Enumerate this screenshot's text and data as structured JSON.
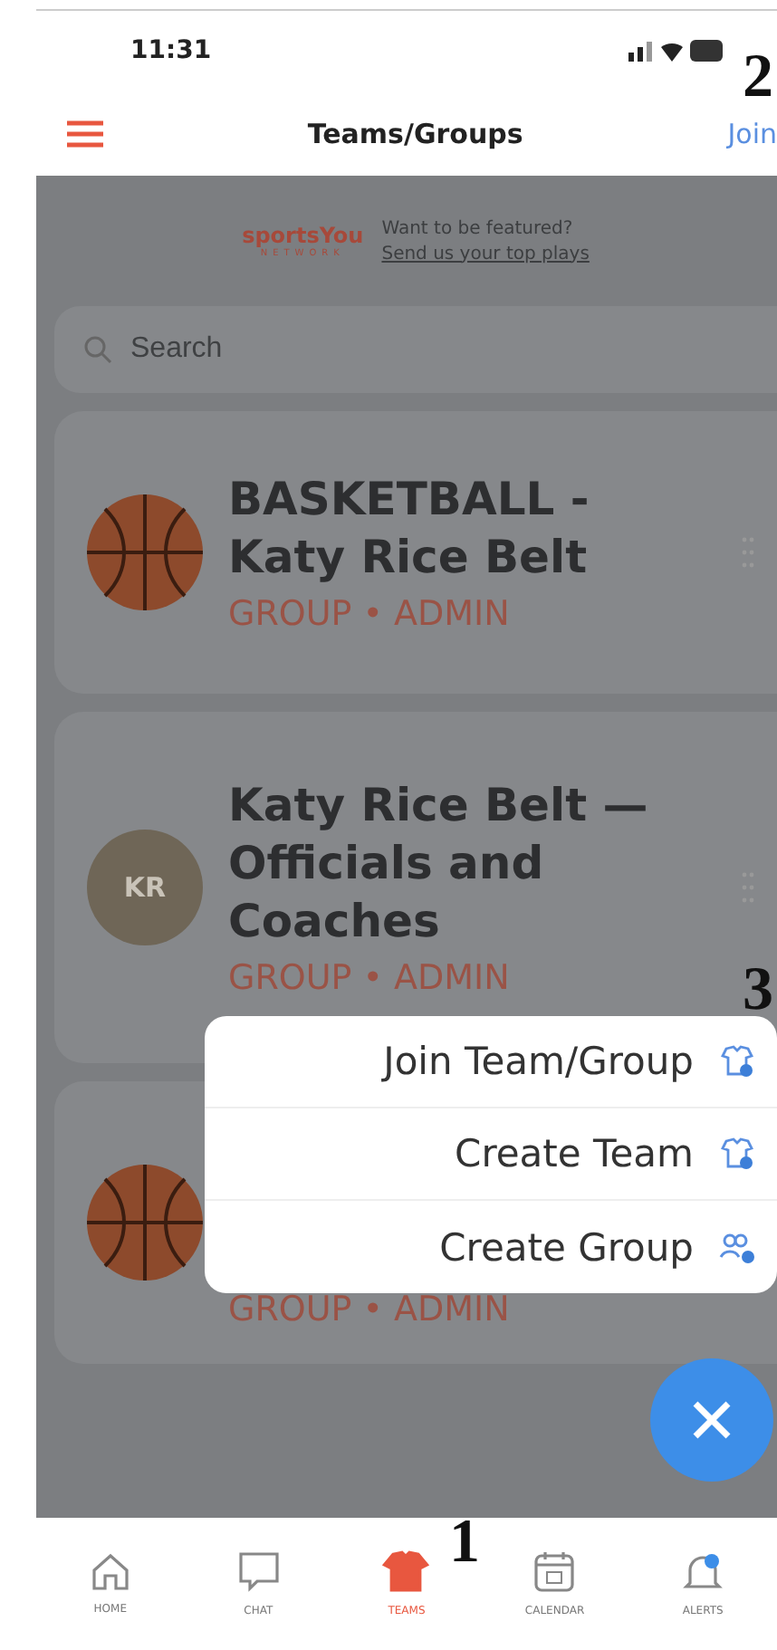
{
  "status_bar": {
    "time": "11:31"
  },
  "header": {
    "title": "Teams/Groups",
    "action": "Join"
  },
  "banner": {
    "logo": "sportsYou",
    "logo_sub": "NETWORK",
    "line_1": "Want to be featured?",
    "line_2": "Send us your top plays"
  },
  "search": {
    "placeholder": "Search"
  },
  "cards": [
    {
      "kind": "photo",
      "title": "BASKETBALL - Katy Rice Belt",
      "subtitle": "GROUP • ADMIN"
    },
    {
      "kind": "initials",
      "initials": "KR",
      "title": "Katy Rice Belt — Officials and Coaches",
      "subtitle": "GROUP • ADMIN"
    },
    {
      "kind": "photo",
      "subtitle": "GROUP • ADMIN"
    }
  ],
  "menu": [
    {
      "label": "Join Team/Group"
    },
    {
      "label": "Create Team"
    },
    {
      "label": "Create Group"
    }
  ],
  "nav": [
    {
      "label": "HOME",
      "selected": false
    },
    {
      "label": "CHAT",
      "selected": false
    },
    {
      "label": "TEAMS",
      "selected": true
    },
    {
      "label": "CALENDAR",
      "selected": false
    },
    {
      "label": "ALERTS",
      "selected": false
    }
  ],
  "callouts": [
    "2",
    "3",
    "1"
  ]
}
